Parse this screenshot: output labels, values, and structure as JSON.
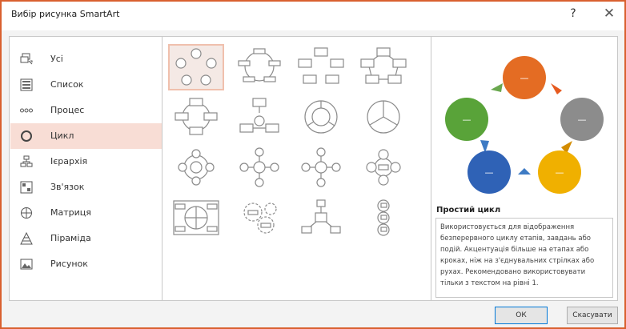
{
  "window": {
    "title": "Вибір рисунка SmartArt",
    "help_label": "?",
    "close_label": "✕"
  },
  "categories": [
    {
      "label": "Усі",
      "icon": "all-icon"
    },
    {
      "label": "Список",
      "icon": "list-icon"
    },
    {
      "label": "Процес",
      "icon": "process-icon"
    },
    {
      "label": "Цикл",
      "icon": "cycle-icon",
      "selected": true
    },
    {
      "label": "Ієрархія",
      "icon": "hierarchy-icon"
    },
    {
      "label": "Зв'язок",
      "icon": "relationship-icon"
    },
    {
      "label": "Матриця",
      "icon": "matrix-icon"
    },
    {
      "label": "Піраміда",
      "icon": "pyramid-icon"
    },
    {
      "label": "Рисунок",
      "icon": "picture-icon"
    }
  ],
  "layouts": [
    {
      "icon": "basic-cycle-icon",
      "selected": true
    },
    {
      "icon": "text-cycle-icon"
    },
    {
      "icon": "block-cycle-icon"
    },
    {
      "icon": "nondirectional-cycle-icon"
    },
    {
      "icon": "continuous-cycle-icon"
    },
    {
      "icon": "segmented-cycle-icon"
    },
    {
      "icon": "pie-segmented-cycle-icon"
    },
    {
      "icon": "basic-pie-icon"
    },
    {
      "icon": "radial-cycle-icon"
    },
    {
      "icon": "basic-radial-icon"
    },
    {
      "icon": "diverging-radial-icon"
    },
    {
      "icon": "radial-venn-icon"
    },
    {
      "icon": "cycle-matrix-icon"
    },
    {
      "icon": "gear-icon"
    },
    {
      "icon": "radial-cluster-icon"
    },
    {
      "icon": "circle-arrow-process-icon"
    }
  ],
  "preview": {
    "title": "Простий цикл",
    "description": "Використовується для відображення безперервного циклу етапів, завдань або подій. Акцентуація більше на етапах або кроках, ніж на з'єднувальних стрілках або рухах. Рекомендовано використовувати тільки з текстом на рівні 1.",
    "node_text": "—",
    "colors": [
      "#e46c23",
      "#8c8c8c",
      "#f0b000",
      "#2f62b6",
      "#59a339"
    ]
  },
  "buttons": {
    "ok": "ОК",
    "cancel": "Скасувати"
  }
}
